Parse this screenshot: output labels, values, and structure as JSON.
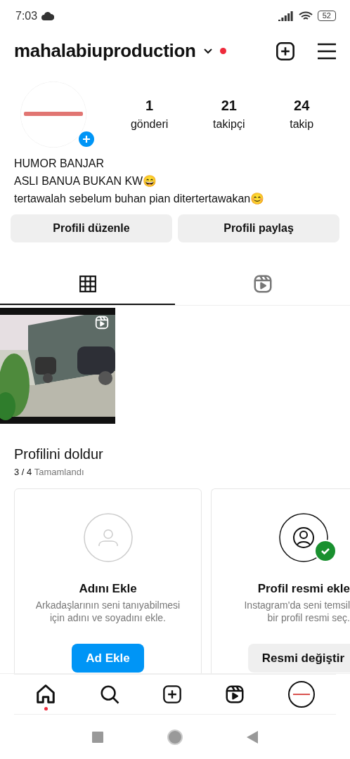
{
  "status_bar": {
    "time": "7:03",
    "battery": "52"
  },
  "header": {
    "username": "mahalabiuproduction",
    "unread": true
  },
  "profile": {
    "stats": [
      {
        "value": "1",
        "label": "gönderi"
      },
      {
        "value": "21",
        "label": "takipçi"
      },
      {
        "value": "24",
        "label": "takip"
      }
    ]
  },
  "bio": [
    "HUMOR BANJAR",
    "ASLI BANUA BUKAN KW😄",
    "tertawalah sebelum buhan pian ditertertawakan😊"
  ],
  "actions": [
    "Profili düzenle",
    "Profili paylaş"
  ],
  "tabs": [
    {
      "kind": "grid",
      "selected": true
    },
    {
      "kind": "reels",
      "selected": false
    }
  ],
  "posts": [
    {
      "kind": "picture"
    }
  ],
  "completion": {
    "title": "Profilini doldur",
    "progress": "3 / 4",
    "progress_label": "Tamamlandı",
    "cards": [
      {
        "title": "Adını Ekle",
        "description": [
          "Arkadaşlarının seni tanıyabilmesi",
          "için adını ve soyadını ekle."
        ],
        "button": "Ad Ekle",
        "done": false
      },
      {
        "title": "Profil resmi ekle",
        "description": [
          "Instagram'da seni temsil",
          "bir profil resmi seç."
        ],
        "button": "Resmi değiştir",
        "done": true
      }
    ]
  },
  "bottom_nav": [
    {
      "kind": "home",
      "selected": true
    },
    {
      "kind": "search",
      "selected": false
    },
    {
      "kind": "create",
      "selected": false
    },
    {
      "kind": "reels",
      "selected": false
    },
    {
      "kind": "profile",
      "selected": false
    }
  ]
}
